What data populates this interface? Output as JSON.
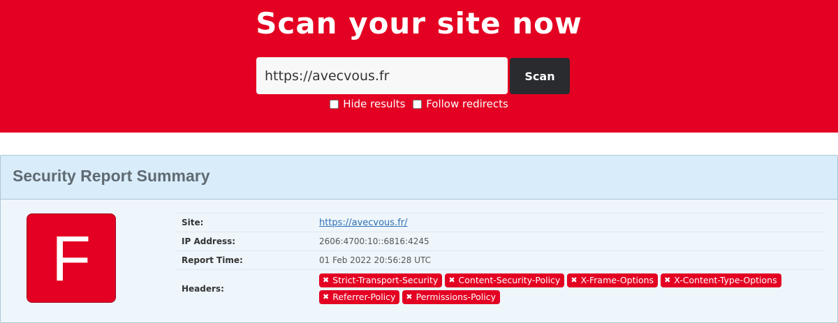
{
  "hero": {
    "title": "Scan your site now",
    "input_value": "https://avecvous.fr",
    "scan_label": "Scan",
    "options": [
      {
        "label": "Hide results",
        "checked": false
      },
      {
        "label": "Follow redirects",
        "checked": false
      }
    ]
  },
  "report": {
    "title": "Security Report Summary",
    "grade": "F",
    "rows": {
      "site": {
        "label": "Site:",
        "value": "https://avecvous.fr/"
      },
      "ip": {
        "label": "IP Address:",
        "value": "2606:4700:10::6816:4245"
      },
      "time": {
        "label": "Report Time:",
        "value": "01 Feb 2022 20:56:28 UTC"
      },
      "headers": {
        "label": "Headers:"
      }
    },
    "headers": [
      {
        "icon": "x-icon",
        "label": "Strict-Transport-Security"
      },
      {
        "icon": "x-icon",
        "label": "Content-Security-Policy"
      },
      {
        "icon": "x-icon",
        "label": "X-Frame-Options"
      },
      {
        "icon": "x-icon",
        "label": "X-Content-Type-Options"
      },
      {
        "icon": "x-icon",
        "label": "Referrer-Policy"
      },
      {
        "icon": "x-icon",
        "label": "Permissions-Policy"
      }
    ]
  },
  "colors": {
    "brand_red": "#e30022",
    "scan_button": "#292b2f",
    "panel_header": "#d9ecfa",
    "panel_body": "#eef6fc"
  }
}
